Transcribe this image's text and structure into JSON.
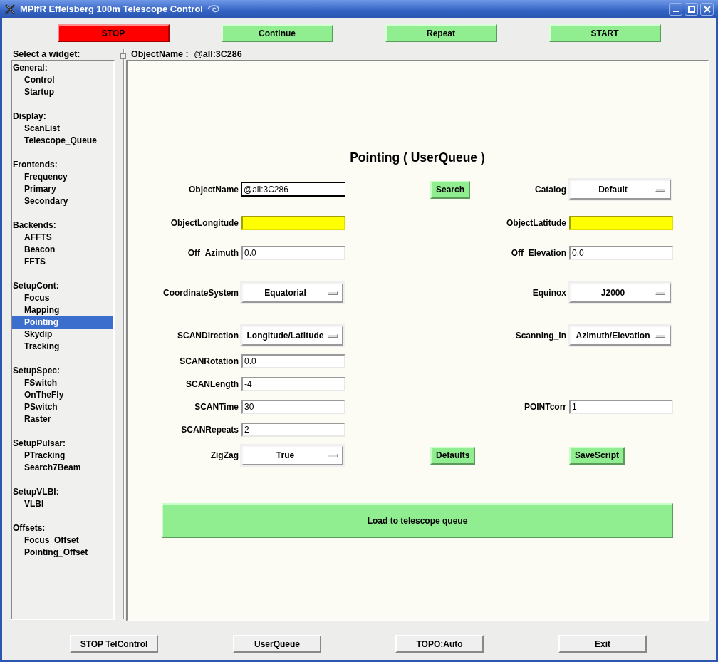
{
  "window": {
    "title": "MPIfR Effelsberg 100m Telescope Control"
  },
  "top_buttons": [
    {
      "label": "STOP",
      "kind": "danger"
    },
    {
      "label": "Continue",
      "kind": "normal"
    },
    {
      "label": "Repeat",
      "kind": "normal"
    },
    {
      "label": "START",
      "kind": "normal"
    }
  ],
  "sidebar": {
    "title": "Select a widget:",
    "groups": [
      {
        "label": "General:",
        "children": [
          {
            "label": "Control",
            "selected": false
          },
          {
            "label": "Startup",
            "selected": false
          }
        ]
      },
      {
        "label": "Display:",
        "children": [
          {
            "label": "ScanList",
            "selected": false
          },
          {
            "label": "Telescope_Queue",
            "selected": false
          }
        ]
      },
      {
        "label": "Frontends:",
        "children": [
          {
            "label": "Frequency",
            "selected": false
          },
          {
            "label": "Primary",
            "selected": false
          },
          {
            "label": "Secondary",
            "selected": false
          }
        ]
      },
      {
        "label": "Backends:",
        "children": [
          {
            "label": "AFFTS",
            "selected": false
          },
          {
            "label": "Beacon",
            "selected": false
          },
          {
            "label": "FFTS",
            "selected": false
          }
        ]
      },
      {
        "label": "SetupCont:",
        "children": [
          {
            "label": "Focus",
            "selected": false
          },
          {
            "label": "Mapping",
            "selected": false
          },
          {
            "label": "Pointing",
            "selected": true
          },
          {
            "label": "Skydip",
            "selected": false
          },
          {
            "label": "Tracking",
            "selected": false
          }
        ]
      },
      {
        "label": "SetupSpec:",
        "children": [
          {
            "label": "FSwitch",
            "selected": false
          },
          {
            "label": "OnTheFly",
            "selected": false
          },
          {
            "label": "PSwitch",
            "selected": false
          },
          {
            "label": "Raster",
            "selected": false
          }
        ]
      },
      {
        "label": "SetupPulsar:",
        "children": [
          {
            "label": "PTracking",
            "selected": false
          },
          {
            "label": "Search7Beam",
            "selected": false
          }
        ]
      },
      {
        "label": "SetupVLBI:",
        "children": [
          {
            "label": "VLBI",
            "selected": false
          }
        ]
      },
      {
        "label": "Offsets:",
        "children": [
          {
            "label": "Focus_Offset",
            "selected": false
          },
          {
            "label": "Pointing_Offset",
            "selected": false
          }
        ]
      }
    ]
  },
  "header": {
    "label": "ObjectName :",
    "value": "@all:3C286"
  },
  "form": {
    "title": "Pointing ( UserQueue )",
    "rows": [
      {
        "left": {
          "kind": "entry",
          "label": "ObjectName",
          "value": "@all:3C286",
          "focused": true,
          "highlighted": false
        },
        "middle": {
          "kind": "button",
          "label": "Search"
        },
        "right": {
          "kind": "select",
          "label": "Catalog",
          "value": "Default"
        }
      },
      {
        "left": {
          "kind": "entry",
          "label": "ObjectLongitude",
          "focused": false,
          "highlighted": true
        },
        "right": {
          "kind": "entry",
          "label": "ObjectLatitude",
          "focused": false,
          "highlighted": true
        }
      },
      {
        "left": {
          "kind": "entry",
          "label": "Off_Azimuth",
          "value": "0.0",
          "focused": false,
          "highlighted": false
        },
        "right": {
          "kind": "entry",
          "label": "Off_Elevation",
          "value": "0.0",
          "focused": false,
          "highlighted": false
        }
      },
      {
        "left": {
          "kind": "select",
          "label": "CoordinateSystem",
          "value": "Equatorial"
        },
        "right": {
          "kind": "select",
          "label": "Equinox",
          "value": "J2000"
        }
      },
      {
        "left": {
          "kind": "select",
          "label": "SCANDirection",
          "value": "Longitude/Latitude"
        },
        "right": {
          "kind": "select",
          "label": "Scanning_in",
          "value": "Azimuth/Elevation"
        }
      },
      {
        "left": {
          "kind": "entry",
          "label": "SCANRotation",
          "value": "0.0",
          "focused": false,
          "highlighted": false
        }
      },
      {
        "left": {
          "kind": "entry",
          "label": "SCANLength",
          "value": "-4",
          "focused": false,
          "highlighted": false
        }
      },
      {
        "left": {
          "kind": "entry",
          "label": "SCANTime",
          "value": "30",
          "focused": false,
          "highlighted": false
        },
        "right": {
          "kind": "entry",
          "label": "POINTcorr",
          "value": "1",
          "focused": false,
          "highlighted": false
        }
      },
      {
        "left": {
          "kind": "entry",
          "label": "SCANRepeats",
          "value": "2",
          "focused": false,
          "highlighted": false
        }
      },
      {
        "left": {
          "kind": "select",
          "label": "ZigZag",
          "value": "True"
        },
        "middle": {
          "kind": "button",
          "label": "Defaults"
        },
        "right": {
          "kind": "button",
          "label": "SaveScript"
        }
      }
    ],
    "load_button": "Load to telescope queue"
  },
  "bottom_buttons": [
    "STOP TelControl",
    "UserQueue",
    "TOPO:Auto",
    "Exit"
  ]
}
